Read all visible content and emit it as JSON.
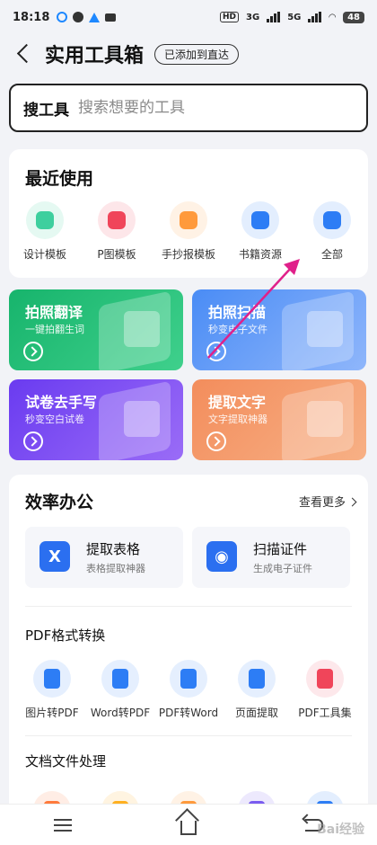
{
  "status": {
    "time": "18:18",
    "network1": "3G",
    "network2": "5G",
    "battery": "48",
    "hd": "HD"
  },
  "header": {
    "title": "实用工具箱",
    "badge": "已添加到直达"
  },
  "search": {
    "label": "搜工具",
    "placeholder": "搜索想要的工具"
  },
  "recent": {
    "title": "最近使用",
    "items": [
      {
        "label": "设计模板",
        "icon": "design-template-icon",
        "color": "#3ecf9e"
      },
      {
        "label": "P图模板",
        "icon": "photo-template-icon",
        "color": "#f0455a"
      },
      {
        "label": "手抄报模板",
        "icon": "poster-template-icon",
        "color": "#ff9a3c"
      },
      {
        "label": "书籍资源",
        "icon": "book-resource-icon",
        "color": "#2d7df5"
      },
      {
        "label": "全部",
        "icon": "grid-all-icon",
        "color": "#2d7df5"
      }
    ]
  },
  "promos": [
    {
      "title": "拍照翻译",
      "sub": "一键拍翻生词",
      "colors": [
        "#17b46c",
        "#3fd08c"
      ]
    },
    {
      "title": "拍照扫描",
      "sub": "秒变电子文件",
      "colors": [
        "#4a8cf5",
        "#8fb6fb"
      ]
    },
    {
      "title": "试卷去手写",
      "sub": "秒变空白试卷",
      "colors": [
        "#6a3bf0",
        "#9a6cf7"
      ]
    },
    {
      "title": "提取文字",
      "sub": "文字提取神器",
      "colors": [
        "#f38d5c",
        "#f7b085"
      ]
    }
  ],
  "office": {
    "title": "效率办公",
    "more": "查看更多",
    "features": [
      {
        "title": "提取表格",
        "sub": "表格提取神器",
        "glyph": "X"
      },
      {
        "title": "扫描证件",
        "sub": "生成电子证件",
        "glyph": "◉"
      }
    ],
    "pdf_title": "PDF格式转换",
    "pdf_items": [
      {
        "label": "图片转PDF",
        "icon": "image-to-pdf-icon",
        "color": "#2d7df5"
      },
      {
        "label": "Word转PDF",
        "icon": "word-to-pdf-icon",
        "color": "#2d7df5"
      },
      {
        "label": "PDF转Word",
        "icon": "pdf-to-word-icon",
        "color": "#2d7df5"
      },
      {
        "label": "页面提取",
        "icon": "page-extract-icon",
        "color": "#2d7df5"
      },
      {
        "label": "PDF工具集",
        "icon": "pdf-toolkit-icon",
        "color": "#f0455a"
      }
    ],
    "doc_title": "文档文件处理",
    "doc_items": [
      {
        "icon": "doc-tool-1-icon",
        "color": "#ff7a3c"
      },
      {
        "icon": "doc-tool-2-icon",
        "color": "#ffb020"
      },
      {
        "icon": "doc-tool-3-icon",
        "color": "#ff9a3c"
      },
      {
        "icon": "doc-tool-4-icon",
        "color": "#7a5cf0"
      },
      {
        "icon": "doc-tool-5-icon",
        "color": "#2d7df5"
      }
    ]
  },
  "watermark": "Bai经验",
  "annotation_color": "#e0208a"
}
